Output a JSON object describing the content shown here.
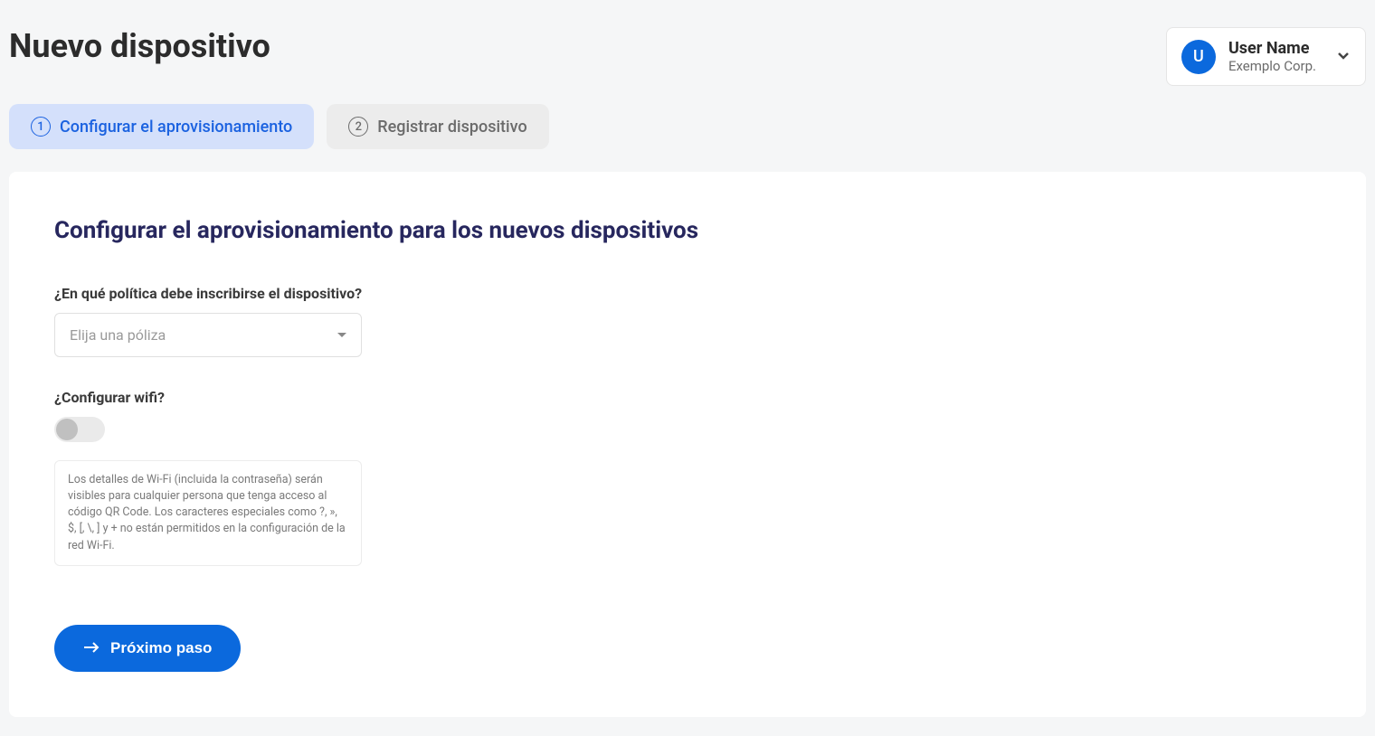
{
  "header": {
    "title": "Nuevo dispositivo",
    "user": {
      "avatar_letter": "U",
      "name": "User Name",
      "company": "Exemplo Corp."
    }
  },
  "tabs": [
    {
      "step": "1",
      "label": "Configurar el aprovisionamiento"
    },
    {
      "step": "2",
      "label": "Registrar dispositivo"
    }
  ],
  "panel": {
    "title": "Configurar el aprovisionamiento para los nuevos dispositivos",
    "policy_label": "¿En qué política debe inscribirse el dispositivo?",
    "policy_placeholder": "Elija una póliza",
    "wifi_label": "¿Configurar wifi?",
    "wifi_info": "Los detalles de Wi-Fi (incluida la contraseña) serán visibles para cualquier persona que tenga acceso al código QR Code. Los caracteres especiales como ?, », $, [, \\, ] y + no están permitidos en la configuración de la red Wi-Fi.",
    "next_button": "Próximo paso"
  }
}
